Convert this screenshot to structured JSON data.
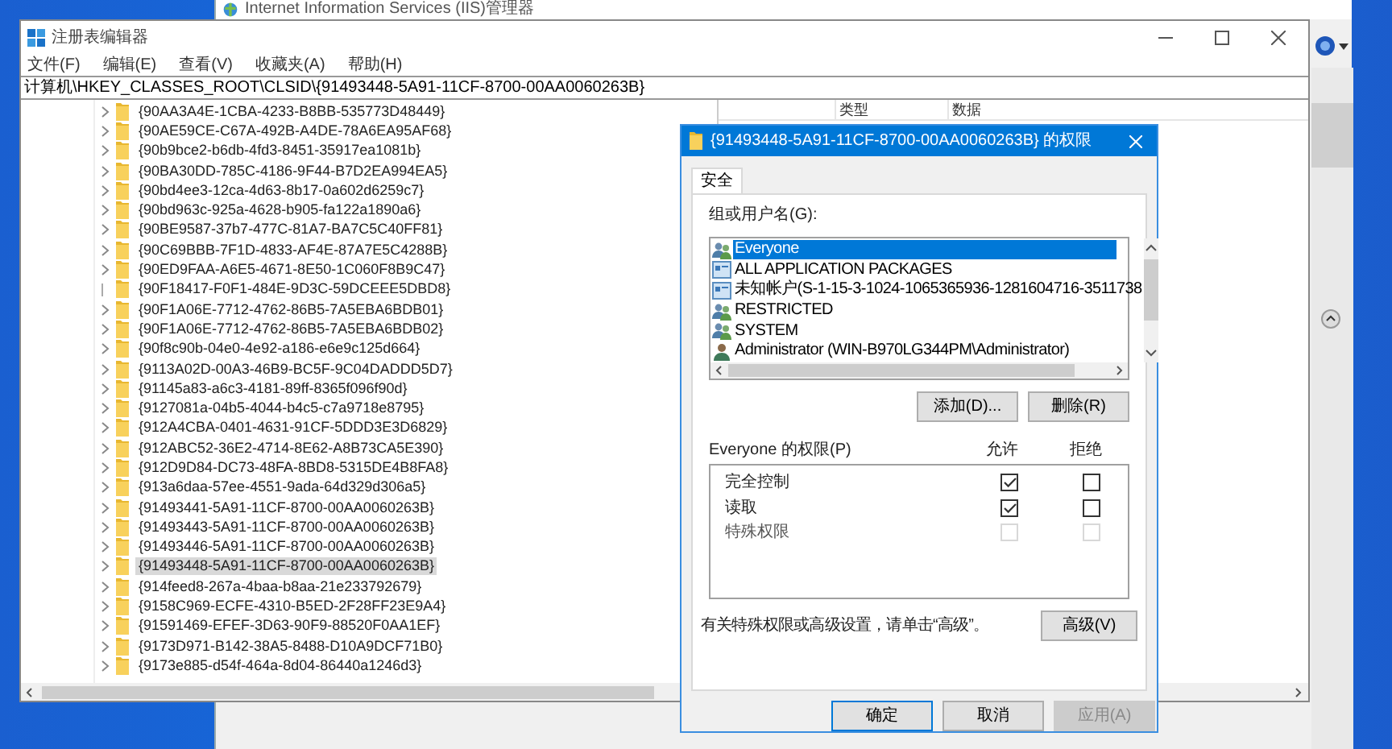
{
  "back_window": {
    "title": "Internet Information Services (IIS)管理器"
  },
  "registry_window": {
    "title": "注册表编辑器",
    "menu": [
      "文件(F)",
      "编辑(E)",
      "查看(V)",
      "收藏夹(A)",
      "帮助(H)"
    ],
    "address": "计算机\\HKEY_CLASSES_ROOT\\CLSID\\{91493448-5A91-11CF-8700-00AA0060263B}",
    "tree": [
      {
        "label": "{90AA3A4E-1CBA-4233-B8BB-535773D48449}",
        "has_children": true,
        "selected": false
      },
      {
        "label": "{90AE59CE-C67A-492B-A4DE-78A6EA95AF68}",
        "has_children": true,
        "selected": false
      },
      {
        "label": "{90b9bce2-b6db-4fd3-8451-35917ea1081b}",
        "has_children": true,
        "selected": false
      },
      {
        "label": "{90BA30DD-785C-4186-9F44-B7D2EA994EA5}",
        "has_children": true,
        "selected": false
      },
      {
        "label": "{90bd4ee3-12ca-4d63-8b17-0a602d6259c7}",
        "has_children": true,
        "selected": false
      },
      {
        "label": "{90bd963c-925a-4628-b905-fa122a1890a6}",
        "has_children": true,
        "selected": false
      },
      {
        "label": "{90BE9587-37b7-477C-81A7-BA7C5C40FF81}",
        "has_children": true,
        "selected": false
      },
      {
        "label": "{90C69BBB-7F1D-4833-AF4E-87A7E5C4288B}",
        "has_children": true,
        "selected": false
      },
      {
        "label": "{90ED9FAA-A6E5-4671-8E50-1C060F8B9C47}",
        "has_children": true,
        "selected": false
      },
      {
        "label": "{90F18417-F0F1-484E-9D3C-59DCEEE5DBD8}",
        "has_children": false,
        "selected": false
      },
      {
        "label": "{90F1A06E-7712-4762-86B5-7A5EBA6BDB01}",
        "has_children": true,
        "selected": false
      },
      {
        "label": "{90F1A06E-7712-4762-86B5-7A5EBA6BDB02}",
        "has_children": true,
        "selected": false
      },
      {
        "label": "{90f8c90b-04e0-4e92-a186-e6e9c125d664}",
        "has_children": true,
        "selected": false
      },
      {
        "label": "{9113A02D-00A3-46B9-BC5F-9C04DADDD5D7}",
        "has_children": true,
        "selected": false
      },
      {
        "label": "{91145a83-a6c3-4181-89ff-8365f096f90d}",
        "has_children": true,
        "selected": false
      },
      {
        "label": "{9127081a-04b5-4044-b4c5-c7a9718e8795}",
        "has_children": true,
        "selected": false
      },
      {
        "label": "{912A4CBA-0401-4631-91CF-5DDD3E3D6829}",
        "has_children": true,
        "selected": false
      },
      {
        "label": "{912ABC52-36E2-4714-8E62-A8B73CA5E390}",
        "has_children": true,
        "selected": false
      },
      {
        "label": "{912D9D84-DC73-48FA-8BD8-5315DE4B8FA8}",
        "has_children": true,
        "selected": false
      },
      {
        "label": "{913a6daa-57ee-4551-9ada-64d329d306a5}",
        "has_children": true,
        "selected": false
      },
      {
        "label": "{91493441-5A91-11CF-8700-00AA0060263B}",
        "has_children": true,
        "selected": false
      },
      {
        "label": "{91493443-5A91-11CF-8700-00AA0060263B}",
        "has_children": true,
        "selected": false
      },
      {
        "label": "{91493446-5A91-11CF-8700-00AA0060263B}",
        "has_children": true,
        "selected": false
      },
      {
        "label": "{91493448-5A91-11CF-8700-00AA0060263B}",
        "has_children": true,
        "selected": true
      },
      {
        "label": "{914feed8-267a-4baa-b8aa-21e233792679}",
        "has_children": true,
        "selected": false
      },
      {
        "label": "{9158C969-ECFE-4310-B5ED-2F28FF23E9A4}",
        "has_children": true,
        "selected": false
      },
      {
        "label": "{91591469-EFEF-3D63-90F9-88520F0AA1EF}",
        "has_children": true,
        "selected": false
      },
      {
        "label": "{9173D971-B142-38A5-8488-D10A9DCF71B0}",
        "has_children": true,
        "selected": false
      },
      {
        "label": "{9173e885-d54f-464a-8d04-86440a1246d3}",
        "has_children": true,
        "selected": false
      }
    ],
    "list_columns": [
      "类型",
      "数据"
    ]
  },
  "dialog": {
    "title": "{91493448-5A91-11CF-8700-00AA0060263B} 的权限",
    "tabs": [
      {
        "label": "安全",
        "selected": true
      }
    ],
    "users_label": "组或用户名(G):",
    "users": [
      {
        "name": "Everyone",
        "kind": "group",
        "selected": true
      },
      {
        "name": "ALL APPLICATION PACKAGES",
        "kind": "package",
        "selected": false
      },
      {
        "name": "未知帐户(S-1-15-3-1024-1065365936-1281604716-3511738",
        "kind": "package",
        "selected": false
      },
      {
        "name": "RESTRICTED",
        "kind": "group",
        "selected": false
      },
      {
        "name": "SYSTEM",
        "kind": "group",
        "selected": false
      },
      {
        "name": "Administrator (WIN-B970LG344PM\\Administrator)",
        "kind": "user",
        "selected": false
      }
    ],
    "add_button": "添加(D)...",
    "remove_button": "删除(R)",
    "permissions_label": "Everyone 的权限(P)",
    "allow_header": "允许",
    "deny_header": "拒绝",
    "permissions": [
      {
        "name": "完全控制",
        "allow": true,
        "deny": false,
        "disabled": false
      },
      {
        "name": "读取",
        "allow": true,
        "deny": false,
        "disabled": false
      },
      {
        "name": "特殊权限",
        "allow": false,
        "deny": false,
        "disabled": true
      }
    ],
    "advanced_hint": "有关特殊权限或高级设置，请单击“高级”。",
    "advanced_button": "高级(V)",
    "buttons": [
      {
        "label": "确定",
        "disabled": false,
        "default": true
      },
      {
        "label": "取消",
        "disabled": false,
        "default": false
      },
      {
        "label": "应用(A)",
        "disabled": true,
        "default": false
      }
    ]
  }
}
